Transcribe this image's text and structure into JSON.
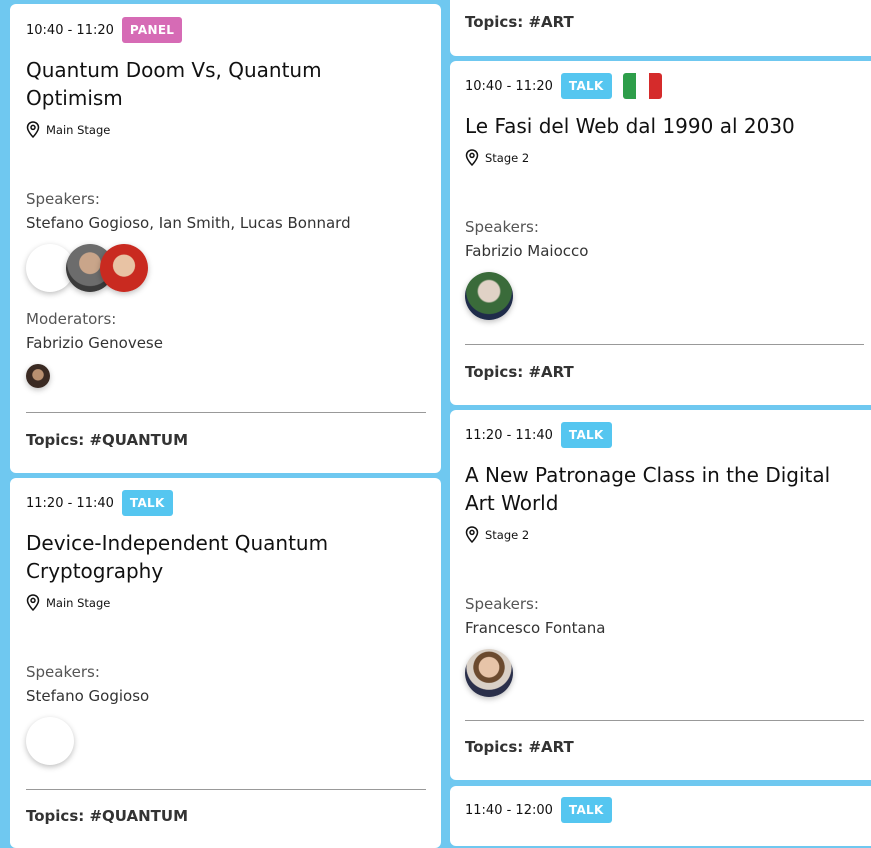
{
  "cards": {
    "quantum_doom": {
      "time": "10:40 - 11:20",
      "badge": "PANEL",
      "title_line1": "Quantum Doom Vs, Quantum",
      "title_line2": "Optimism",
      "location": "Main Stage",
      "speakers_label": "Speakers:",
      "speakers": "Stefano Gogioso, Ian Smith, Lucas Bonnard",
      "moderators_label": "Moderators:",
      "moderators": "Fabrizio Genovese",
      "topics": "Topics: #QUANTUM"
    },
    "device_independent": {
      "time": "11:20 - 11:40",
      "badge": "TALK",
      "title_line1": "Device-Independent Quantum",
      "title_line2": "Cryptography",
      "location": "Main Stage",
      "speakers_label": "Speakers:",
      "speakers": "Stefano Gogioso",
      "topics": "Topics: #QUANTUM"
    },
    "previous_art": {
      "topics": "Topics: #ART"
    },
    "fasi_web": {
      "time": "10:40 - 11:20",
      "badge": "TALK",
      "title": "Le Fasi del Web dal 1990 al 2030",
      "location": "Stage 2",
      "speakers_label": "Speakers:",
      "speakers": "Fabrizio Maiocco",
      "topics": "Topics: #ART"
    },
    "patronage": {
      "time": "11:20 - 11:40",
      "badge": "TALK",
      "title_line1": "A New Patronage Class in the Digital",
      "title_line2": "Art World",
      "location": "Stage 2",
      "speakers_label": "Speakers:",
      "speakers": "Francesco Fontana",
      "topics": "Topics: #ART"
    },
    "next_talk": {
      "time": "11:40 - 12:00",
      "badge": "TALK"
    }
  },
  "colors": {
    "background": "#6fc8f0",
    "panel_badge": "#d66bb5",
    "talk_badge": "#55c6f0",
    "flag_green": "#2e9e4a",
    "flag_white": "#ffffff",
    "flag_red": "#d52b2b"
  }
}
